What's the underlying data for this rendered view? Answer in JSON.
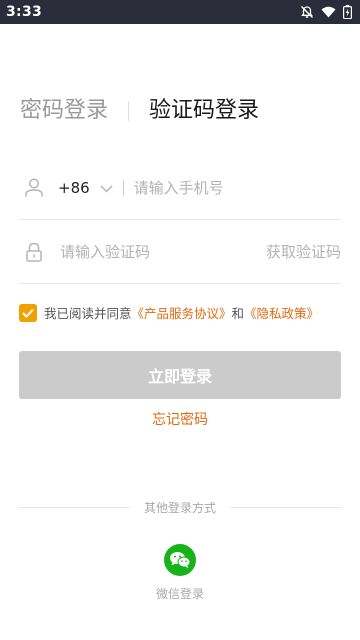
{
  "status_bar": {
    "time": "3:33",
    "icons": [
      "notifications-off-icon",
      "wifi-icon",
      "battery-charging-icon"
    ]
  },
  "tabs": {
    "password_login": "密码登录",
    "code_login": "验证码登录",
    "active": "code_login"
  },
  "phone": {
    "country_code": "+86",
    "placeholder": "请输入手机号",
    "value": ""
  },
  "code": {
    "placeholder": "请输入验证码",
    "value": "",
    "get_code_label": "获取验证码"
  },
  "agreement": {
    "checked": true,
    "prefix": "我已阅读并同意",
    "service_link": "《产品服务协议》",
    "conjunction": "和",
    "privacy_link": "《隐私政策》"
  },
  "login_button": "立即登录",
  "forgot_password": "忘记密码",
  "other_login": {
    "title": "其他登录方式",
    "wechat_label": "微信登录"
  },
  "colors": {
    "status_bar": "#2b2b3a",
    "accent": "#f0a000",
    "link": "#e06a10",
    "button_disabled": "#cbcbcb",
    "wechat": "#16b31a"
  }
}
